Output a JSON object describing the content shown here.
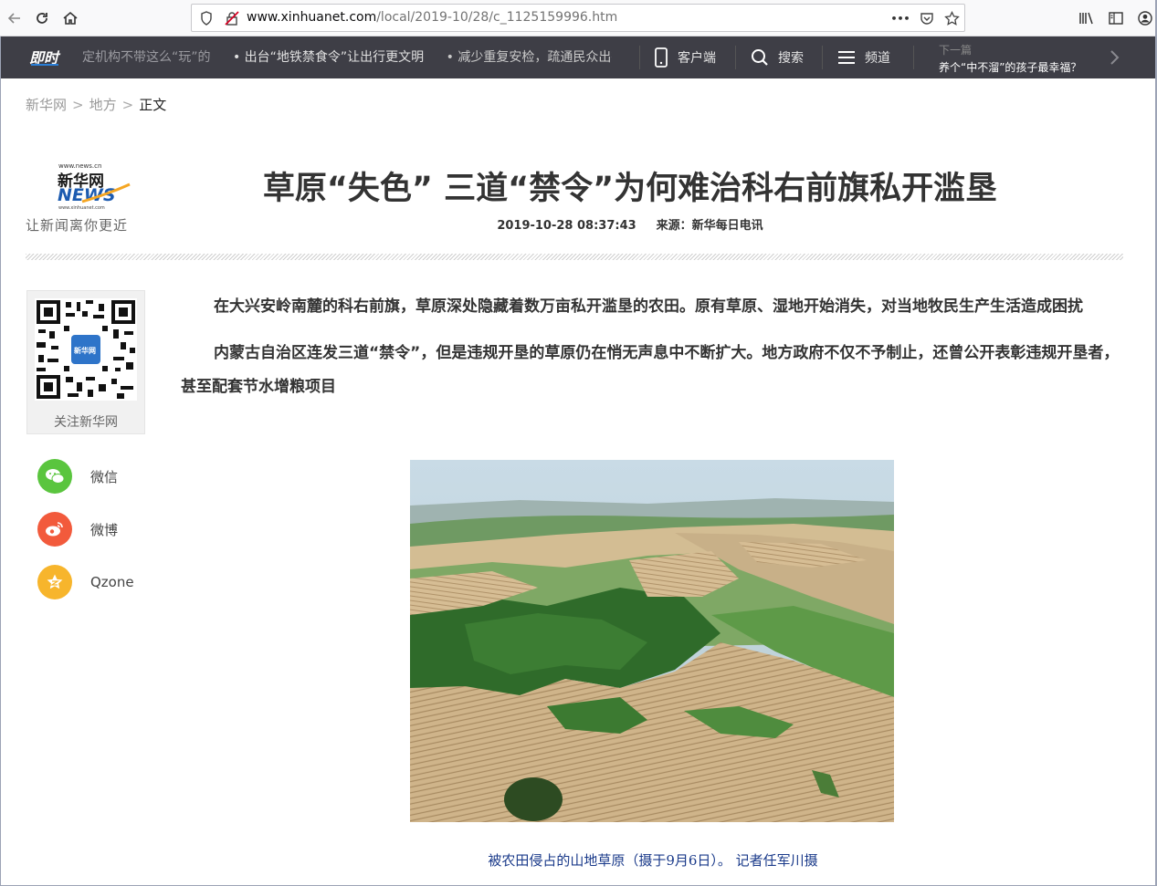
{
  "browser": {
    "url_domain": "www.xinhuanet.com",
    "url_path": "/local/2019-10/28/c_1125159996.htm",
    "more_glyph": "•••"
  },
  "topbar": {
    "logo_text": "即时",
    "ticker": [
      "定机构不带这么“玩”的",
      "• 出台“地铁禁食令”让出行更文明",
      "• 减少重复安检，疏通民众出行"
    ],
    "client_label": "客户端",
    "search_label": "搜索",
    "channel_label": "频道",
    "next_label": "下一篇",
    "next_title": "养个“中不溜”的孩子最幸福？"
  },
  "breadcrumb": {
    "home": "新华网",
    "section": "地方",
    "current": "正文",
    "sep": ">"
  },
  "logo": {
    "site": "www.news.cn",
    "name": "新华网",
    "news": "NEWS",
    "sub_site": "www.xinhuanet.com",
    "slogan": "让新闻离你更近"
  },
  "article": {
    "headline": "草原“失色” 三道“禁令”为何难治科右前旗私开滥垦",
    "datetime": "2019-10-28 08:37:43",
    "source": "来源：新华每日电讯",
    "paragraphs": [
      "在大兴安岭南麓的科右前旗，草原深处隐藏着数万亩私开滥垦的农田。原有草原、湿地开始消失，对当地牧民生产生活造成困扰",
      "内蒙古自治区连发三道“禁令”，但是违规开垦的草原仍在悄无声息中不断扩大。地方政府不仅不予制止，还曾公开表彰违规开垦者，甚至配套节水增粮项目"
    ],
    "photo_caption": "被农田侵占的山地草原（摄于9月6日）。 记者任军川摄"
  },
  "sidebar": {
    "qr_label": "关注新华网",
    "qr_badge": "新华网",
    "share": [
      {
        "label": "微信",
        "color": "#5ac53e"
      },
      {
        "label": "微博",
        "color": "#f25a3c"
      },
      {
        "label": "Qzone",
        "color": "#f7b52c"
      }
    ]
  }
}
